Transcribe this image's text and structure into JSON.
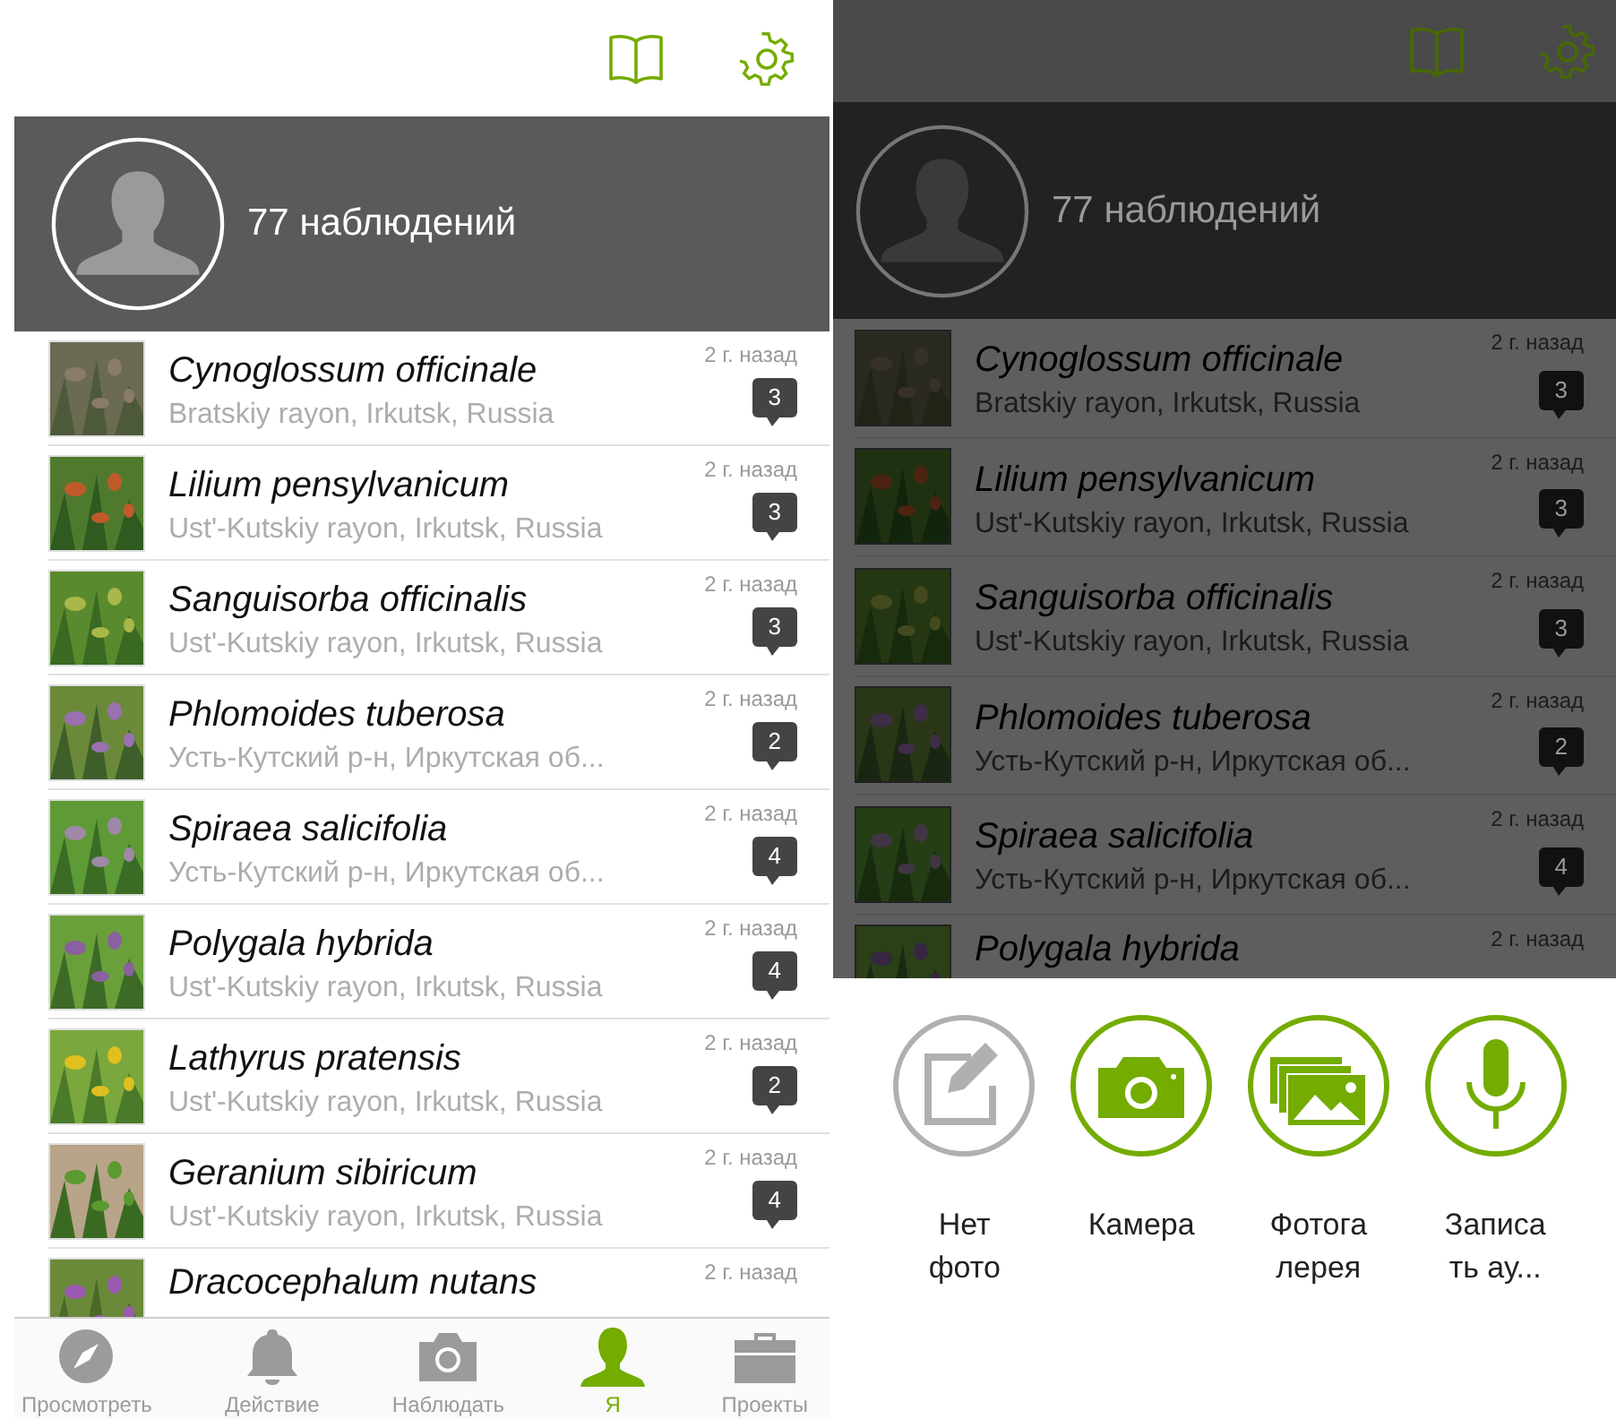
{
  "screens": [
    {
      "dimmed": false,
      "profile": {
        "count": "77 наблюдений"
      },
      "observations": [
        {
          "title": "Cynoglossum officinale",
          "place": "Bratskiy rayon, Irkutsk, Russia",
          "time": "2 г. назад",
          "comments": "3"
        },
        {
          "title": "Lilium pensylvanicum",
          "place": "Ust'-Kutskiy rayon, Irkutsk, Russia",
          "time": "2 г. назад",
          "comments": "3"
        },
        {
          "title": "Sanguisorba officinalis",
          "place": "Ust'-Kutskiy rayon, Irkutsk, Russia",
          "time": "2 г. назад",
          "comments": "3"
        },
        {
          "title": "Phlomoides tuberosa",
          "place": "Усть-Кутский р-н, Иркутская об...",
          "time": "2 г. назад",
          "comments": "2"
        },
        {
          "title": "Spiraea salicifolia",
          "place": "Усть-Кутский р-н, Иркутская об...",
          "time": "2 г. назад",
          "comments": "4"
        },
        {
          "title": "Polygala hybrida",
          "place": "Ust'-Kutskiy rayon, Irkutsk, Russia",
          "time": "2 г. назад",
          "comments": "4"
        },
        {
          "title": "Lathyrus pratensis",
          "place": "Ust'-Kutskiy rayon, Irkutsk, Russia",
          "time": "2 г. назад",
          "comments": "2"
        },
        {
          "title": "Geranium sibiricum",
          "place": "Ust'-Kutskiy rayon, Irkutsk, Russia",
          "time": "2 г. назад",
          "comments": "4"
        },
        {
          "title": "Dracocephalum nutans",
          "time": "2 г. назад"
        }
      ],
      "tab_bar": [
        {
          "kind": "explore",
          "label": "Просмотреть",
          "selected": false
        },
        {
          "kind": "activity",
          "label": "Действие",
          "selected": false
        },
        {
          "kind": "observe",
          "label": "Наблюдать",
          "selected": false
        },
        {
          "kind": "me",
          "label": "Я",
          "selected": true
        },
        {
          "kind": "projects",
          "label": "Проекты",
          "selected": false
        }
      ]
    },
    {
      "dimmed": true,
      "profile": {
        "count": "77 наблюдений"
      },
      "observations": [
        {
          "title": "Cynoglossum officinale",
          "place": "Bratskiy rayon, Irkutsk, Russia",
          "time": "2 г. назад",
          "comments": "3"
        },
        {
          "title": "Lilium pensylvanicum",
          "place": "Ust'-Kutskiy rayon, Irkutsk, Russia",
          "time": "2 г. назад",
          "comments": "3"
        },
        {
          "title": "Sanguisorba officinalis",
          "place": "Ust'-Kutskiy rayon, Irkutsk, Russia",
          "time": "2 г. назад",
          "comments": "3"
        },
        {
          "title": "Phlomoides tuberosa",
          "place": "Усть-Кутский р-н, Иркутская об...",
          "time": "2 г. назад",
          "comments": "2"
        },
        {
          "title": "Spiraea salicifolia",
          "place": "Усть-Кутский р-н, Иркутская об...",
          "time": "2 г. назад",
          "comments": "4"
        },
        {
          "title": "Polygala hybrida",
          "time": "2 г. назад"
        }
      ],
      "sheet": [
        {
          "kind": "no_photo",
          "label": "Нет фото"
        },
        {
          "kind": "camera",
          "label": "Камера"
        },
        {
          "kind": "gallery",
          "label": "Фотогалерея"
        },
        {
          "kind": "audio",
          "label": "Записать ау..."
        }
      ]
    }
  ]
}
